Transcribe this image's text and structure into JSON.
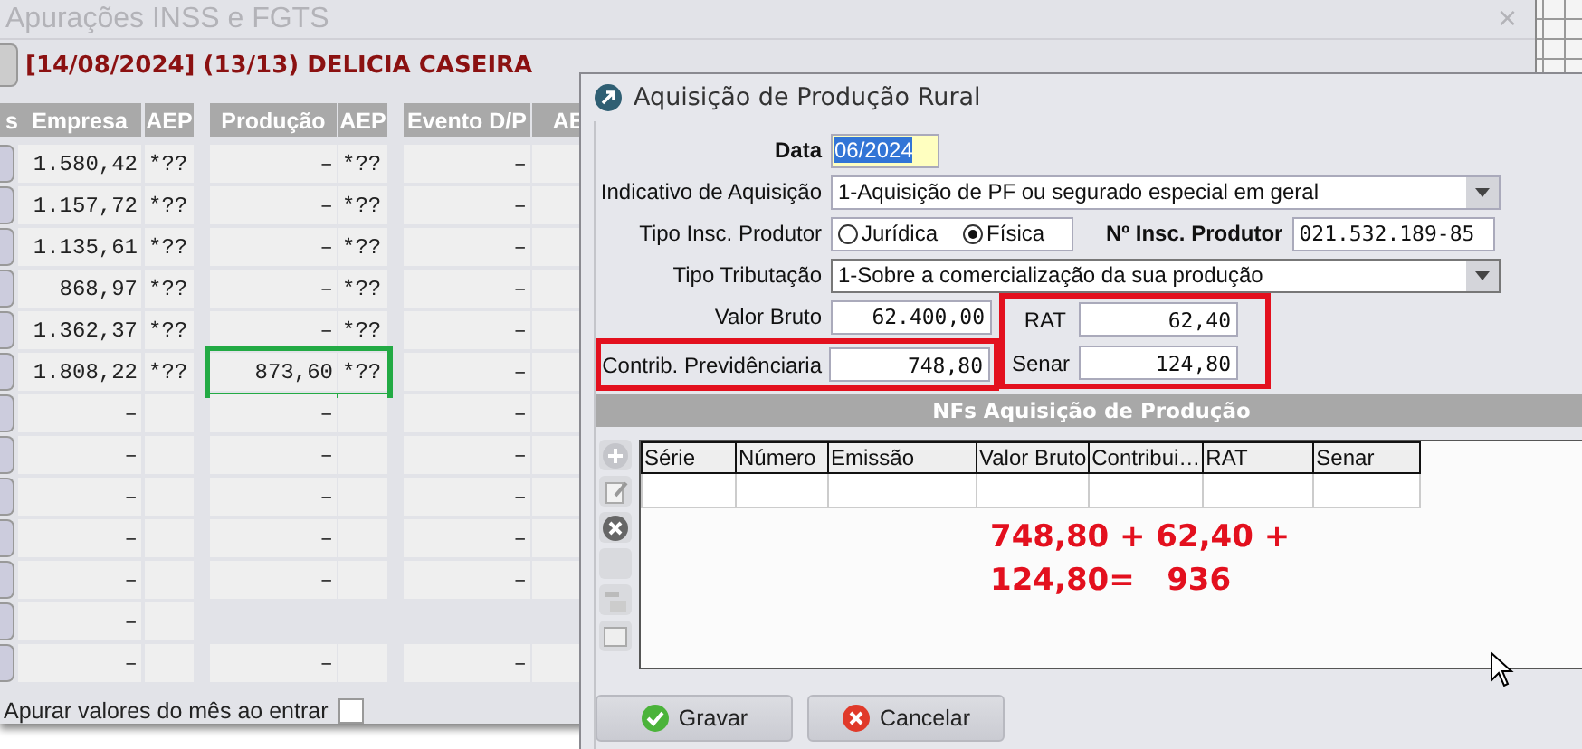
{
  "window": {
    "title": "Apurações INSS e FGTS",
    "close": "×"
  },
  "header": {
    "title": "[14/08/2024] (13/13) DELICIA CASEIRA"
  },
  "table": {
    "columns": [
      "s",
      "Empresa",
      "AEP",
      "Produção",
      "AEP",
      "Evento D/P",
      "AE"
    ],
    "rows": [
      {
        "empresa": "1.580,42",
        "aep": "*??",
        "producao": "–",
        "aep2": "*??",
        "evento": "–",
        "highlight": false
      },
      {
        "empresa": "1.157,72",
        "aep": "*??",
        "producao": "–",
        "aep2": "*??",
        "evento": "–",
        "highlight": false
      },
      {
        "empresa": "1.135,61",
        "aep": "*??",
        "producao": "–",
        "aep2": "*??",
        "evento": "–",
        "highlight": false
      },
      {
        "empresa": "868,97",
        "aep": "*??",
        "producao": "–",
        "aep2": "*??",
        "evento": "–",
        "highlight": false
      },
      {
        "empresa": "1.362,37",
        "aep": "*??",
        "producao": "–",
        "aep2": "*??",
        "evento": "–",
        "highlight": false
      },
      {
        "empresa": "1.808,22",
        "aep": "*??",
        "producao": "873,60",
        "aep2": "*??",
        "evento": "–",
        "highlight": true
      },
      {
        "empresa": "–",
        "aep": null,
        "producao": "–",
        "aep2": null,
        "evento": "–",
        "highlight": false
      },
      {
        "empresa": "–",
        "aep": null,
        "producao": "–",
        "aep2": null,
        "evento": "–",
        "highlight": false
      },
      {
        "empresa": "–",
        "aep": null,
        "producao": "–",
        "aep2": null,
        "evento": "–",
        "highlight": false
      },
      {
        "empresa": "–",
        "aep": null,
        "producao": "–",
        "aep2": null,
        "evento": "–",
        "highlight": false
      },
      {
        "empresa": "–",
        "aep": null,
        "producao": "–",
        "aep2": null,
        "evento": "–",
        "highlight": false
      },
      {
        "empresa": "–",
        "aep": null,
        "producao": null,
        "aep2": null,
        "evento": null,
        "highlight": false
      },
      {
        "empresa": "–",
        "aep": null,
        "producao": "–",
        "aep2": null,
        "evento": "–",
        "highlight": false
      }
    ]
  },
  "auto_calc": {
    "label": "Apurar valores do mês ao entrar",
    "checked": false
  },
  "dialog": {
    "title": "Aquisição de Produção Rural",
    "data": {
      "label": "Data",
      "value": "06/2024",
      "selected": true
    },
    "indicativo": {
      "label": "Indicativo de Aquisição",
      "value": "1-Aquisição de PF ou segurado especial em geral"
    },
    "tipo_insc": {
      "label": "Tipo Insc. Produtor",
      "options": [
        {
          "label": "Jurídica",
          "selected": false
        },
        {
          "label": "Física",
          "selected": true
        }
      ]
    },
    "insc": {
      "label": "Nº Insc. Produtor",
      "value": "021.532.189-85"
    },
    "tributacao": {
      "label": "Tipo Tributação",
      "value": "1-Sobre a comercialização da sua produção"
    },
    "valor_bruto": {
      "label": "Valor Bruto",
      "value": "62.400,00"
    },
    "contrib": {
      "label": "Contrib. Previdênciaria",
      "value": "748,80",
      "highlight": true
    },
    "taxes": {
      "highlight": true,
      "fields": [
        {
          "label": "RAT",
          "value": "62,40"
        },
        {
          "label": "Senar",
          "value": "124,80"
        }
      ]
    },
    "nf_section": {
      "title": "NFs Aquisição de Produção",
      "columns": [
        "Série",
        "Número",
        "Emissão",
        "Valor Bruto",
        "Contribui…",
        "RAT",
        "Senar"
      ],
      "note_lines": [
        "748,80 + 62,40 +",
        "124,80=   936"
      ]
    },
    "buttons": [
      {
        "kind": "save",
        "label": "Gravar"
      },
      {
        "kind": "cancel",
        "label": "Cancelar"
      }
    ]
  }
}
